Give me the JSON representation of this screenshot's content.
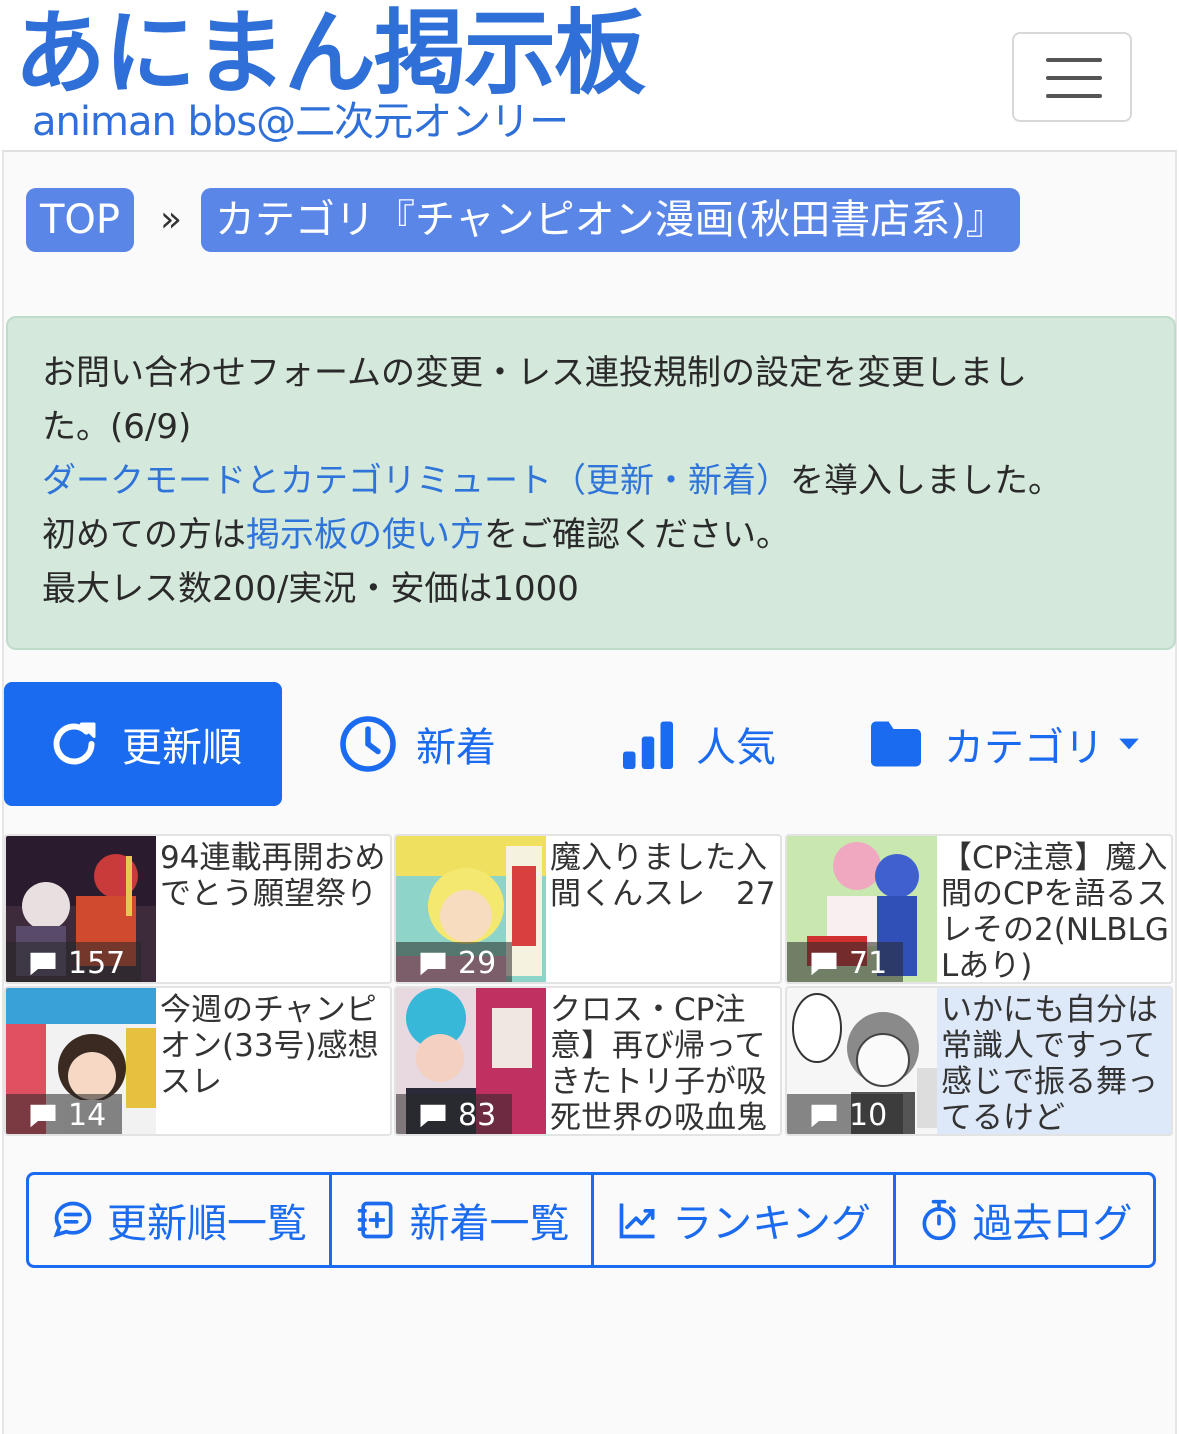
{
  "header": {
    "logo_title": "あにまん掲示板",
    "logo_subtitle": "animan bbs@二次元オンリー",
    "menu_icon": "hamburger-icon"
  },
  "breadcrumb": {
    "top": "TOP",
    "separator": "»",
    "category": "カテゴリ『チャンピオン漫画(秋田書店系)』"
  },
  "notice": {
    "line1": "お問い合わせフォームの変更・レス連投規制の設定を変更しまし",
    "line2": "た。(6/9)",
    "dark_mode_link": "ダークモードとカテゴリミュート（更新・新着）",
    "dark_mode_suffix": "を導入しました。",
    "guide_prefix": "初めての方は",
    "guide_link": "掲示板の使い方",
    "guide_suffix": "をご確認ください。",
    "limits": "最大レス数200/実況・安価は1000"
  },
  "tabs": [
    {
      "label": "更新順",
      "icon": "refresh-icon"
    },
    {
      "label": "新着",
      "icon": "clock-icon"
    },
    {
      "label": "人気",
      "icon": "bar-chart-icon"
    },
    {
      "label": "カテゴリ",
      "icon": "folder-icon"
    }
  ],
  "threads": [
    {
      "title": "94連載再開おめでとう願望祭り",
      "count": "157"
    },
    {
      "title": "魔入りました入間くんスレ　27",
      "count": "29"
    },
    {
      "title": "【CP注意】魔入間のCPを語るスレその2(NLBLGLあり)",
      "count": "71"
    },
    {
      "title": "今週のチャンピオン(33号)感想スレ",
      "count": "14"
    },
    {
      "title": "クロス・CP注意】再び帰ってきたトリ子が吸死世界の吸血鬼",
      "count": "83"
    },
    {
      "title": "いかにも自分は常識人ですって感じで振る舞ってるけど",
      "count": "10"
    }
  ],
  "bottom_buttons": [
    {
      "label": "更新順一覧",
      "icon": "chat-icon"
    },
    {
      "label": "新着一覧",
      "icon": "new-post-icon"
    },
    {
      "label": "ランキング",
      "icon": "trending-icon"
    },
    {
      "label": "過去ログ",
      "icon": "stopwatch-icon"
    }
  ],
  "colors": {
    "brand": "#2f6fd8",
    "primary": "#1a6bf0",
    "crumb_bg": "#5a86e8",
    "notice_bg": "#d4e8dc"
  }
}
